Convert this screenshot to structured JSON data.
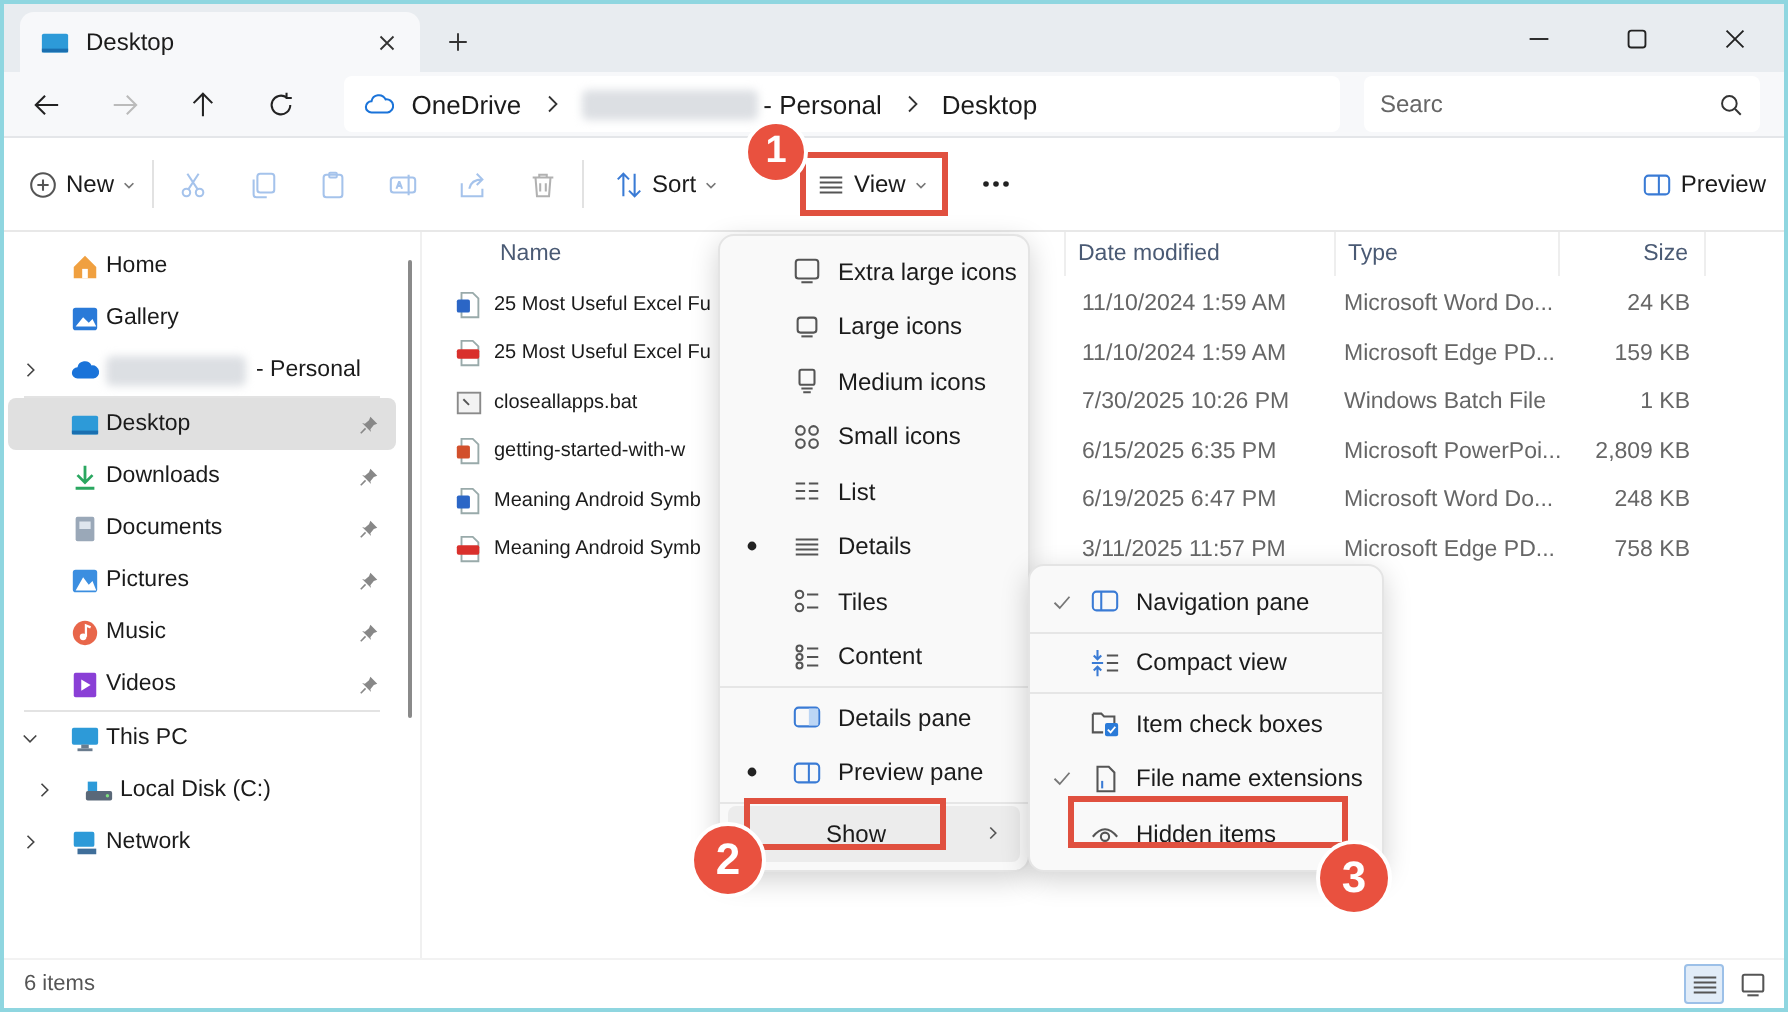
{
  "window": {
    "tabs": [
      {
        "title": "Desktop",
        "selected": true
      }
    ]
  },
  "address_bar": {
    "segments": [
      {
        "label": "OneDrive",
        "kind": "cloud"
      },
      {
        "label": "- Personal",
        "kind": "plain",
        "redacted": true
      },
      {
        "label": "Desktop",
        "kind": "plain"
      }
    ]
  },
  "search": {
    "placeholder": "Searc"
  },
  "toolbar": {
    "groups": [
      [
        {
          "kind": "new",
          "label": "New",
          "dropdown": true,
          "disabled": false
        }
      ],
      [
        {
          "kind": "cut",
          "disabled": true
        },
        {
          "kind": "copy",
          "disabled": true
        },
        {
          "kind": "paste",
          "disabled": true
        },
        {
          "kind": "rename",
          "disabled": true
        },
        {
          "kind": "share",
          "disabled": true
        },
        {
          "kind": "delete",
          "disabled": true
        }
      ],
      [
        {
          "kind": "sort",
          "label": "Sort",
          "dropdown": true,
          "disabled": false
        },
        {
          "kind": "view",
          "label": "View",
          "dropdown": true,
          "disabled": false
        },
        {
          "kind": "more",
          "disabled": false
        }
      ]
    ],
    "preview": {
      "label": "Preview"
    }
  },
  "sidebar": {
    "sections": [
      [
        {
          "label": "Home",
          "kind": "home",
          "selected": false
        },
        {
          "label": "Gallery",
          "kind": "gallery",
          "selected": false
        },
        {
          "label": "- Personal",
          "kind": "cloud",
          "selected": false,
          "redacted": true,
          "expanded": false
        }
      ],
      [
        {
          "label": "Desktop",
          "kind": "desktop",
          "selected": true,
          "pinned": true
        },
        {
          "label": "Downloads",
          "kind": "downloads",
          "selected": false,
          "pinned": true
        },
        {
          "label": "Documents",
          "kind": "documents",
          "selected": false,
          "pinned": true
        },
        {
          "label": "Pictures",
          "kind": "pictures",
          "selected": false,
          "pinned": true
        },
        {
          "label": "Music",
          "kind": "music",
          "selected": false,
          "pinned": true
        },
        {
          "label": "Videos",
          "kind": "videos",
          "selected": false,
          "pinned": true
        }
      ],
      [
        {
          "label": "This PC",
          "kind": "pc",
          "selected": false,
          "expanded": true,
          "children": [
            {
              "label": "Local Disk (C:)",
              "kind": "disk",
              "selected": false,
              "expanded": false
            }
          ]
        },
        {
          "label": "Network",
          "kind": "network",
          "selected": false,
          "expanded": false
        }
      ]
    ]
  },
  "table": {
    "columns": [
      "Name",
      "Date modified",
      "Type",
      "Size"
    ],
    "rows": [
      {
        "kind": "word",
        "name": "25 Most Useful Excel Fu",
        "date": "11/10/2024 1:59 AM",
        "type": "Microsoft Word Do...",
        "size": "24 KB"
      },
      {
        "kind": "pdf",
        "name": "25 Most Useful Excel Fu",
        "date": "11/10/2024 1:59 AM",
        "type": "Microsoft Edge PD...",
        "size": "159 KB"
      },
      {
        "kind": "bat",
        "name": "closeallapps.bat",
        "date": "7/30/2025 10:26 PM",
        "type": "Windows Batch File",
        "size": "1 KB"
      },
      {
        "kind": "ppt",
        "name": "getting-started-with-w",
        "date": "6/15/2025 6:35 PM",
        "type": "Microsoft PowerPoi...",
        "size": "2,809 KB"
      },
      {
        "kind": "word",
        "name": "Meaning Android Symb",
        "date": "6/19/2025 6:47 PM",
        "type": "Microsoft Word Do...",
        "size": "248 KB"
      },
      {
        "kind": "pdf",
        "name": "Meaning Android Symb",
        "date": "3/11/2025 11:57 PM",
        "type": "Microsoft Edge PD...",
        "size": "758 KB"
      }
    ]
  },
  "view_menu": {
    "sections": [
      [
        {
          "kind": "xl",
          "label": "Extra large icons",
          "selected": false
        },
        {
          "kind": "large",
          "label": "Large icons",
          "selected": false
        },
        {
          "kind": "medium",
          "label": "Medium icons",
          "selected": false
        },
        {
          "kind": "small",
          "label": "Small icons",
          "selected": false
        },
        {
          "kind": "list",
          "label": "List",
          "selected": false
        },
        {
          "kind": "details",
          "label": "Details",
          "selected": true
        },
        {
          "kind": "tiles",
          "label": "Tiles",
          "selected": false
        },
        {
          "kind": "content",
          "label": "Content",
          "selected": false
        }
      ],
      [
        {
          "kind": "details-pane",
          "label": "Details pane",
          "selected": false
        },
        {
          "kind": "preview-pane",
          "label": "Preview pane",
          "selected": true
        }
      ],
      [
        {
          "kind": "submenu",
          "label": "Show"
        }
      ]
    ]
  },
  "show_menu": {
    "items": [
      {
        "kind": "nav-pane",
        "label": "Navigation pane",
        "checked": true
      },
      {
        "kind": "compact",
        "label": "Compact view",
        "checked": false
      },
      {
        "kind": "checkboxes",
        "label": "Item check boxes",
        "checked": false
      },
      {
        "kind": "extensions",
        "label": "File name extensions",
        "checked": true
      },
      {
        "kind": "hidden",
        "label": "Hidden items",
        "checked": false
      }
    ]
  },
  "status_bar": {
    "text": "6 items",
    "view_buttons": [
      {
        "kind": "details",
        "selected": true
      },
      {
        "kind": "large-icons",
        "selected": false
      }
    ]
  },
  "annotations": [
    {
      "label": "1"
    },
    {
      "label": "2"
    },
    {
      "label": "3"
    }
  ]
}
